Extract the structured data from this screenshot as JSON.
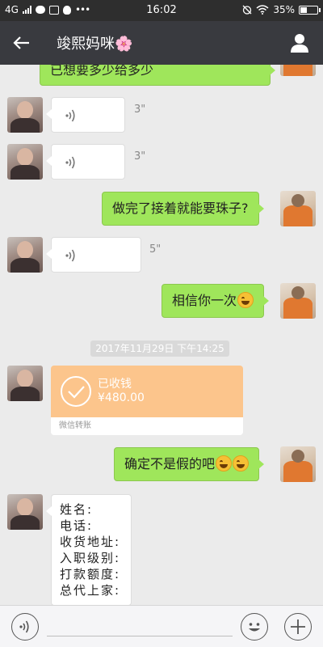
{
  "status_bar": {
    "network": "4G",
    "time": "16:02",
    "battery": "35%",
    "battery_level": 0.35
  },
  "header": {
    "title": "竣熙妈咪🌸",
    "back_icon": "back-arrow-icon",
    "profile_icon": "person-icon"
  },
  "messages": {
    "m0": {
      "sender": "self",
      "text": "已想要多少给多少"
    },
    "m1": {
      "sender": "other",
      "type": "voice",
      "duration": "3\""
    },
    "m2": {
      "sender": "other",
      "type": "voice",
      "duration": "3\""
    },
    "m3": {
      "sender": "self",
      "text": "做完了接着就能要珠子?"
    },
    "m4": {
      "sender": "other",
      "type": "voice",
      "duration": "5\""
    },
    "m5": {
      "sender": "self",
      "text": "相信你一次"
    },
    "timestamp": "2017年11月29日 下午14:25",
    "m6": {
      "sender": "other",
      "type": "transfer",
      "status": "已收钱",
      "amount": "¥480.00",
      "footer": "微信转账"
    },
    "m7": {
      "sender": "self",
      "text": "确定不是假的吧"
    },
    "m8": {
      "sender": "other",
      "lines": [
        "姓名:",
        "电话:",
        "收货地址:",
        "入职级别:",
        "打款额度:",
        "总代上家:"
      ]
    }
  },
  "input_bar": {
    "voice_icon": "voice-input-icon",
    "emoji_icon": "emoji-icon",
    "plus_icon": "plus-icon"
  }
}
